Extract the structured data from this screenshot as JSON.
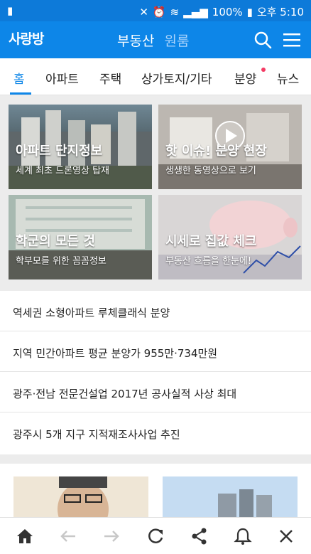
{
  "status_bar": {
    "battery_text": "100%",
    "time": "오후 5:10"
  },
  "app_bar": {
    "logo": "사랑방",
    "title": "부동산",
    "subtitle": "원룸"
  },
  "tabs": [
    {
      "label": "홈"
    },
    {
      "label": "아파트"
    },
    {
      "label": "주택"
    },
    {
      "label": "상가토지/기타"
    },
    {
      "label": "분양"
    },
    {
      "label": "뉴스"
    }
  ],
  "cards": [
    {
      "headline": "아파트 단지정보",
      "subline": "세계 최초 드론영상 탑재"
    },
    {
      "headline": "핫 이슈! 분양 현장",
      "subline": "생생한 동영상으로 보기"
    },
    {
      "headline": "학군의 모든 것",
      "subline": "학부모를 위한 꼼꼼정보"
    },
    {
      "headline": "시세로 집값 체크",
      "subline": "부동산 흐름을 한눈에!"
    }
  ],
  "news": [
    {
      "title": "역세권 소형아파트 루체클래식 분양"
    },
    {
      "title": "지역 민간아파트 평균 분양가 955만·734만원"
    },
    {
      "title": "광주·전남 전문건설업 2017년 공사실적 사상 최대"
    },
    {
      "title": "광주시 5개 지구 지적재조사사업 추진"
    }
  ],
  "colors": {
    "brand": "#0d86e8",
    "accent_dot": "#f43b64"
  },
  "icons": [
    "home-icon",
    "back-icon",
    "forward-icon",
    "refresh-icon",
    "share-icon",
    "bell-icon",
    "close-icon"
  ]
}
